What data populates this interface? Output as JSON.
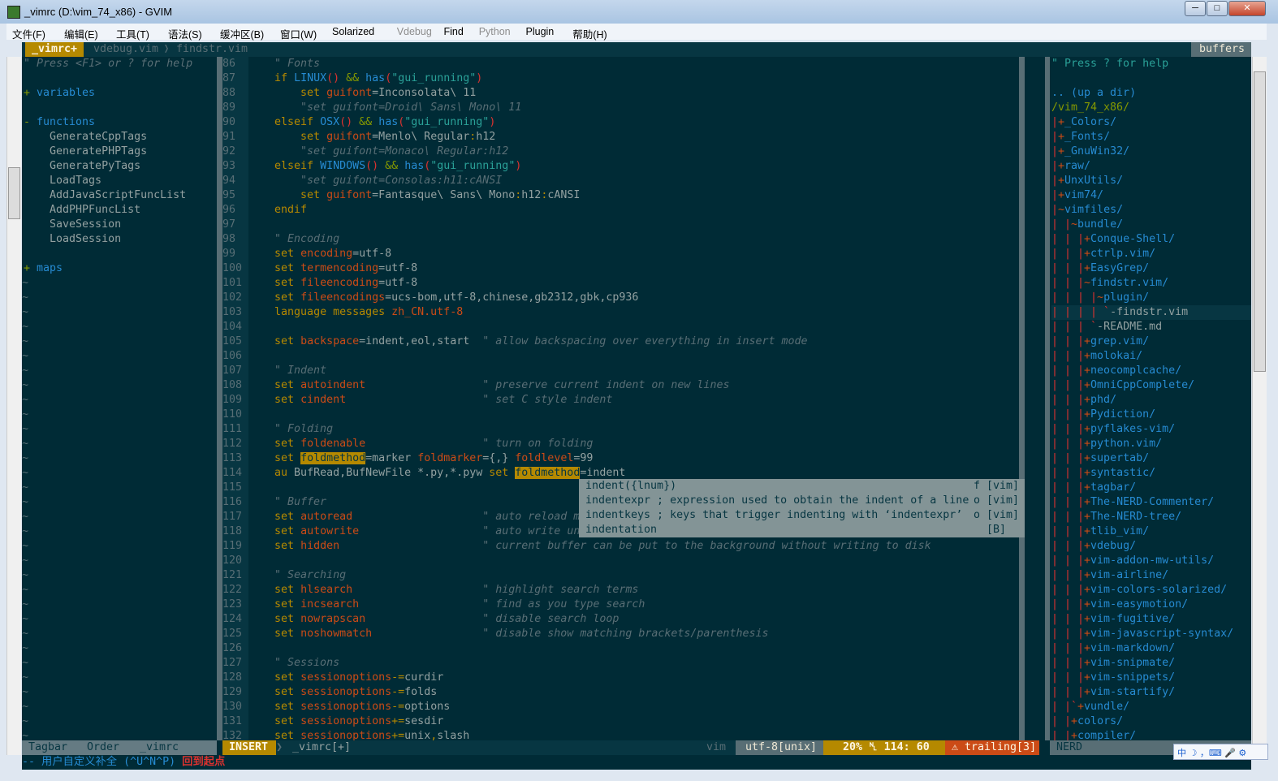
{
  "window": {
    "title": "_vimrc (D:\\vim_74_x86) - GVIM",
    "minimize": "─",
    "maximize": "□",
    "close": "✕"
  },
  "menu": [
    {
      "label": "文件(F)"
    },
    {
      "label": "编辑(E)"
    },
    {
      "label": "工具(T)"
    },
    {
      "label": "语法(S)"
    },
    {
      "label": "缓冲区(B)"
    },
    {
      "label": "窗口(W)"
    },
    {
      "label": "Solarized"
    },
    {
      "label": "Vdebug",
      "disabled": true
    },
    {
      "label": "Find"
    },
    {
      "label": "Python",
      "disabled": true
    },
    {
      "label": "Plugin"
    },
    {
      "label": "帮助(H)"
    }
  ],
  "tabs": {
    "active": "_vimrc+",
    "others": [
      "vdebug.vim",
      "findstr.vim"
    ],
    "buffers_label": "buffers"
  },
  "tagbar": {
    "help": "\" Press <F1> or ? for help",
    "groups": [
      {
        "sign": "+",
        "name": "variables",
        "items": []
      },
      {
        "sign": "-",
        "name": "functions",
        "items": [
          "GenerateCppTags",
          "GeneratePHPTags",
          "GeneratePyTags",
          "LoadTags",
          "AddJavaScriptFuncList",
          "AddPHPFuncList",
          "SaveSession",
          "LoadSession"
        ]
      },
      {
        "sign": "+",
        "name": "maps",
        "items": []
      }
    ]
  },
  "code": {
    "first_line": 86,
    "lines": [
      [
        [
          "cm",
          "    \" Fonts"
        ]
      ],
      [
        [
          "base",
          "    "
        ],
        [
          "y",
          "if"
        ],
        [
          "base",
          " "
        ],
        [
          "b",
          "LINUX"
        ],
        [
          "r",
          "()"
        ],
        [
          "base",
          " "
        ],
        [
          "g",
          "&&"
        ],
        [
          "base",
          " "
        ],
        [
          "b",
          "has"
        ],
        [
          "r",
          "("
        ],
        [
          "c",
          "\"gui_running\""
        ],
        [
          "r",
          ")"
        ]
      ],
      [
        [
          "base",
          "        "
        ],
        [
          "y",
          "set"
        ],
        [
          "base",
          " "
        ],
        [
          "o",
          "guifont"
        ],
        [
          "base",
          "=Inconsolata\\ 11"
        ]
      ],
      [
        [
          "cm",
          "        \"set guifont=Droid\\ Sans\\ Mono\\ 11"
        ]
      ],
      [
        [
          "base",
          "    "
        ],
        [
          "y",
          "elseif"
        ],
        [
          "base",
          " "
        ],
        [
          "b",
          "OSX"
        ],
        [
          "r",
          "()"
        ],
        [
          "base",
          " "
        ],
        [
          "g",
          "&&"
        ],
        [
          "base",
          " "
        ],
        [
          "b",
          "has"
        ],
        [
          "r",
          "("
        ],
        [
          "c",
          "\"gui_running\""
        ],
        [
          "r",
          ")"
        ]
      ],
      [
        [
          "base",
          "        "
        ],
        [
          "y",
          "set"
        ],
        [
          "base",
          " "
        ],
        [
          "o",
          "guifont"
        ],
        [
          "base",
          "=Menlo\\ Regular"
        ],
        [
          "y",
          ":"
        ],
        [
          "base",
          "h12"
        ]
      ],
      [
        [
          "cm",
          "        \"set guifont=Monaco\\ Regular:h12"
        ]
      ],
      [
        [
          "base",
          "    "
        ],
        [
          "y",
          "elseif"
        ],
        [
          "base",
          " "
        ],
        [
          "b",
          "WINDOWS"
        ],
        [
          "r",
          "()"
        ],
        [
          "base",
          " "
        ],
        [
          "g",
          "&&"
        ],
        [
          "base",
          " "
        ],
        [
          "b",
          "has"
        ],
        [
          "r",
          "("
        ],
        [
          "c",
          "\"gui_running\""
        ],
        [
          "r",
          ")"
        ]
      ],
      [
        [
          "cm",
          "        \"set guifont=Consolas:h11:cANSI"
        ]
      ],
      [
        [
          "base",
          "        "
        ],
        [
          "y",
          "set"
        ],
        [
          "base",
          " "
        ],
        [
          "o",
          "guifont"
        ],
        [
          "base",
          "=Fantasque\\ Sans\\ Mono"
        ],
        [
          "y",
          ":"
        ],
        [
          "base",
          "h12"
        ],
        [
          "y",
          ":"
        ],
        [
          "base",
          "cANSI"
        ]
      ],
      [
        [
          "base",
          "    "
        ],
        [
          "y",
          "endif"
        ]
      ],
      [],
      [
        [
          "cm",
          "    \" Encoding"
        ]
      ],
      [
        [
          "base",
          "    "
        ],
        [
          "y",
          "set"
        ],
        [
          "base",
          " "
        ],
        [
          "o",
          "encoding"
        ],
        [
          "base",
          "=utf-8"
        ]
      ],
      [
        [
          "base",
          "    "
        ],
        [
          "y",
          "set"
        ],
        [
          "base",
          " "
        ],
        [
          "o",
          "termencoding"
        ],
        [
          "base",
          "=utf-8"
        ]
      ],
      [
        [
          "base",
          "    "
        ],
        [
          "y",
          "set"
        ],
        [
          "base",
          " "
        ],
        [
          "o",
          "fileencoding"
        ],
        [
          "base",
          "=utf-8"
        ]
      ],
      [
        [
          "base",
          "    "
        ],
        [
          "y",
          "set"
        ],
        [
          "base",
          " "
        ],
        [
          "o",
          "fileencodings"
        ],
        [
          "base",
          "=ucs-bom,utf-8,chinese,gb2312,gbk,cp936"
        ]
      ],
      [
        [
          "base",
          "    "
        ],
        [
          "y",
          "language messages"
        ],
        [
          "base",
          " "
        ],
        [
          "o",
          "zh_CN.utf-8"
        ]
      ],
      [],
      [
        [
          "base",
          "    "
        ],
        [
          "y",
          "set"
        ],
        [
          "base",
          " "
        ],
        [
          "o",
          "backspace"
        ],
        [
          "base",
          "=indent,eol,start  "
        ],
        [
          "cm",
          "\" allow backspacing over everything in insert mode"
        ]
      ],
      [],
      [
        [
          "cm",
          "    \" Indent"
        ]
      ],
      [
        [
          "base",
          "    "
        ],
        [
          "y",
          "set"
        ],
        [
          "base",
          " "
        ],
        [
          "o",
          "autoindent"
        ],
        [
          "base",
          "                  "
        ],
        [
          "cm",
          "\" preserve current indent on new lines"
        ]
      ],
      [
        [
          "base",
          "    "
        ],
        [
          "y",
          "set"
        ],
        [
          "base",
          " "
        ],
        [
          "o",
          "cindent"
        ],
        [
          "base",
          "                     "
        ],
        [
          "cm",
          "\" set C style indent"
        ]
      ],
      [],
      [
        [
          "cm",
          "    \" Folding"
        ]
      ],
      [
        [
          "base",
          "    "
        ],
        [
          "y",
          "set"
        ],
        [
          "base",
          " "
        ],
        [
          "o",
          "foldenable"
        ],
        [
          "base",
          "                  "
        ],
        [
          "cm",
          "\" turn on folding"
        ]
      ],
      [
        [
          "base",
          "    "
        ],
        [
          "y",
          "set"
        ],
        [
          "base",
          " "
        ],
        [
          "hl",
          "foldmethod"
        ],
        [
          "base",
          "=marker "
        ],
        [
          "o",
          "foldmarker"
        ],
        [
          "base",
          "={,} "
        ],
        [
          "o",
          "foldlevel"
        ],
        [
          "base",
          "=99"
        ]
      ],
      [
        [
          "base",
          "    "
        ],
        [
          "y",
          "au"
        ],
        [
          "base",
          " BufRead,BufNewFile *.py,*.pyw "
        ],
        [
          "y",
          "set"
        ],
        [
          "base",
          " "
        ],
        [
          "hl",
          "foldmethod"
        ],
        [
          "base",
          "=indent"
        ]
      ],
      [],
      [
        [
          "cm",
          "    \" Buffer"
        ]
      ],
      [
        [
          "base",
          "    "
        ],
        [
          "y",
          "set"
        ],
        [
          "base",
          " "
        ],
        [
          "o",
          "autoread"
        ],
        [
          "base",
          "                    "
        ],
        [
          "cm",
          "\" auto reload m"
        ]
      ],
      [
        [
          "base",
          "    "
        ],
        [
          "y",
          "set"
        ],
        [
          "base",
          " "
        ],
        [
          "o",
          "autowrite"
        ],
        [
          "base",
          "                   "
        ],
        [
          "cm",
          "\" auto write un"
        ]
      ],
      [
        [
          "base",
          "    "
        ],
        [
          "y",
          "set"
        ],
        [
          "base",
          " "
        ],
        [
          "o",
          "hidden"
        ],
        [
          "base",
          "                      "
        ],
        [
          "cm",
          "\" current buffer can be put to the background without writing to disk"
        ]
      ],
      [],
      [
        [
          "cm",
          "    \" Searching"
        ]
      ],
      [
        [
          "base",
          "    "
        ],
        [
          "y",
          "set"
        ],
        [
          "base",
          " "
        ],
        [
          "o",
          "hlsearch"
        ],
        [
          "base",
          "                    "
        ],
        [
          "cm",
          "\" highlight search terms"
        ]
      ],
      [
        [
          "base",
          "    "
        ],
        [
          "y",
          "set"
        ],
        [
          "base",
          " "
        ],
        [
          "o",
          "incsearch"
        ],
        [
          "base",
          "                   "
        ],
        [
          "cm",
          "\" find as you type search"
        ]
      ],
      [
        [
          "base",
          "    "
        ],
        [
          "y",
          "set"
        ],
        [
          "base",
          " "
        ],
        [
          "o",
          "nowrapscan"
        ],
        [
          "base",
          "                  "
        ],
        [
          "cm",
          "\" disable search loop"
        ]
      ],
      [
        [
          "base",
          "    "
        ],
        [
          "y",
          "set"
        ],
        [
          "base",
          " "
        ],
        [
          "o",
          "noshowmatch"
        ],
        [
          "base",
          "                 "
        ],
        [
          "cm",
          "\" disable show matching brackets/parenthesis"
        ]
      ],
      [],
      [
        [
          "cm",
          "    \" Sessions"
        ]
      ],
      [
        [
          "base",
          "    "
        ],
        [
          "y",
          "set"
        ],
        [
          "base",
          " "
        ],
        [
          "o",
          "sessionoptions"
        ],
        [
          "y",
          "-="
        ],
        [
          "base",
          "curdir"
        ]
      ],
      [
        [
          "base",
          "    "
        ],
        [
          "y",
          "set"
        ],
        [
          "base",
          " "
        ],
        [
          "o",
          "sessionoptions"
        ],
        [
          "y",
          "-="
        ],
        [
          "base",
          "folds"
        ]
      ],
      [
        [
          "base",
          "    "
        ],
        [
          "y",
          "set"
        ],
        [
          "base",
          " "
        ],
        [
          "o",
          "sessionoptions"
        ],
        [
          "y",
          "-="
        ],
        [
          "base",
          "options"
        ]
      ],
      [
        [
          "base",
          "    "
        ],
        [
          "y",
          "set"
        ],
        [
          "base",
          " "
        ],
        [
          "o",
          "sessionoptions"
        ],
        [
          "y",
          "+="
        ],
        [
          "base",
          "sesdir"
        ]
      ],
      [
        [
          "base",
          "    "
        ],
        [
          "y",
          "set"
        ],
        [
          "base",
          " "
        ],
        [
          "o",
          "sessionoptions"
        ],
        [
          "y",
          "+="
        ],
        [
          "base",
          "unix"
        ],
        [
          "y",
          ","
        ],
        [
          "base",
          "slash"
        ]
      ]
    ]
  },
  "completion": [
    {
      "word": "indent({lnum})",
      "kind": "f",
      "menu": "[vim]"
    },
    {
      "word": "indentexpr ; expression used to obtain the indent of a line",
      "kind": "o",
      "menu": "[vim]"
    },
    {
      "word": "indentkeys ; keys that trigger indenting with ‘indentexpr’",
      "kind": "o",
      "menu": "[vim]"
    },
    {
      "word": "indentation",
      "kind": "",
      "menu": "[B]"
    }
  ],
  "nerdtree": {
    "help": "\" Press ? for help",
    "up": ".. (up a dir)",
    "root": "/vim_74_x86/",
    "items": [
      "|+_Colors/",
      "|+_Fonts/",
      "|+_GnuWin32/",
      "|+raw/",
      "|+UnxUtils/",
      "|+vim74/",
      "|~vimfiles/",
      "| |~bundle/",
      "| | |+Conque-Shell/",
      "| | |+ctrlp.vim/",
      "| | |+EasyGrep/",
      "| | |~findstr.vim/",
      "| | | |~plugin/",
      "| | | | `-findstr.vim",
      "| | | `-README.md",
      "| | |+grep.vim/",
      "| | |+molokai/",
      "| | |+neocomplcache/",
      "| | |+OmniCppComplete/",
      "| | |+phd/",
      "| | |+Pydiction/",
      "| | |+pyflakes-vim/",
      "| | |+python.vim/",
      "| | |+supertab/",
      "| | |+syntastic/",
      "| | |+tagbar/",
      "| | |+The-NERD-Commenter/",
      "| | |+The-NERD-tree/",
      "| | |+tlib_vim/",
      "| | |+vdebug/",
      "| | |+vim-addon-mw-utils/",
      "| | |+vim-airline/",
      "| | |+vim-colors-solarized/",
      "| | |+vim-easymotion/",
      "| | |+vim-fugitive/",
      "| | |+vim-javascript-syntax/",
      "| | |+vim-markdown/",
      "| | |+vim-snipmate/",
      "| | |+vim-snippets/",
      "| | |+vim-startify/",
      "| |`+vundle/",
      "| |+colors/",
      "| |+compiler/"
    ],
    "cursor_item": "| | | | `-findstr.vim"
  },
  "statusline": {
    "tagbar": [
      "Tagbar",
      "Order",
      "_vimrc"
    ],
    "mode": "INSERT",
    "file": "_vimrc[+]",
    "filetype": "vim",
    "encoding": "utf-8[unix]",
    "position": "20% ␤ 114: 60",
    "warning": "⚠ trailing[3]",
    "nerd": "NERD"
  },
  "cmdline": {
    "mode": "-- 用户自定义补全 (^U^N^P)",
    "message": "回到起点"
  },
  "ime": {
    "label": "中 ☽ ，⌨ 🎤 ⚙"
  },
  "colors": {
    "background": "#002b36",
    "base02": "#073642",
    "yellow": "#b58900",
    "orange": "#cb4b16",
    "red": "#dc322f",
    "blue": "#268bd2",
    "cyan": "#2aa198",
    "green": "#859900"
  }
}
